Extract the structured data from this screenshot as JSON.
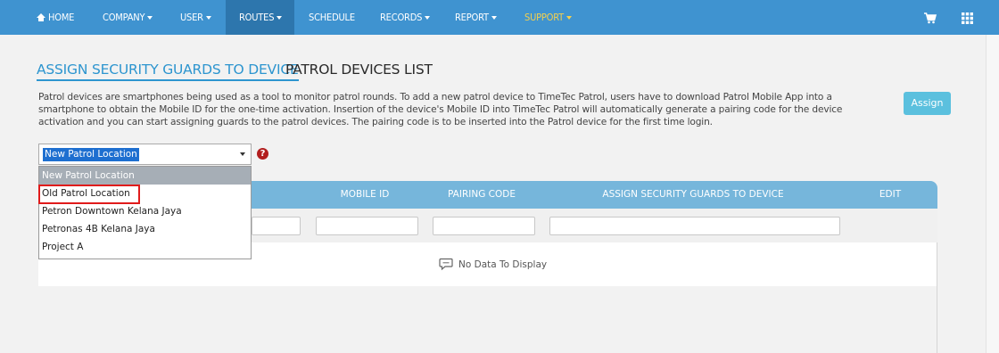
{
  "nav": {
    "home": "HOME",
    "company": "COMPANY",
    "user": "USER",
    "routes": "ROUTES",
    "schedule": "SCHEDULE",
    "records": "RECORDS",
    "report": "REPORT",
    "support": "SUPPORT",
    "active_item": "ROUTES",
    "bar_color": "#3f93d0",
    "active_color": "#2d76ad",
    "support_color": "#f4d04e"
  },
  "tabs": {
    "assign": "ASSIGN SECURITY GUARDS TO DEVICE",
    "devices": "PATROL DEVICES LIST",
    "active": "ASSIGN SECURITY GUARDS TO DEVICE"
  },
  "description": "Patrol devices are smartphones being used as a tool to monitor patrol rounds. To add a new patrol device to TimeTec Patrol, users have to download Patrol Mobile App into a smartphone to obtain the Mobile ID for the one-time activation. Insertion of the device's Mobile ID into TimeTec Patrol will automatically generate a pairing code for the device activation and you can start assigning guards to the patrol devices. The pairing code is to be inserted into the Patrol device for the first time login.",
  "assign_button": "Assign",
  "location_select": {
    "value": "New Patrol Location",
    "options": [
      "New Patrol Location",
      "Old Patrol Location",
      "Petron Downtown Kelana Jaya",
      "Petronas 4B Kelana Jaya",
      "Project A"
    ],
    "selected_index": 0,
    "highlighted_option": "Old Patrol Location"
  },
  "help_icon": "?",
  "table": {
    "columns": [
      "MOBILE ID",
      "PAIRING CODE",
      "ASSIGN SECURITY GUARDS TO DEVICE",
      "EDIT"
    ],
    "empty_message": "No Data To Display",
    "header_color": "#76b6db"
  },
  "icons": [
    "home-icon",
    "cart-icon",
    "grid-icon",
    "help-icon",
    "chat-icon"
  ]
}
